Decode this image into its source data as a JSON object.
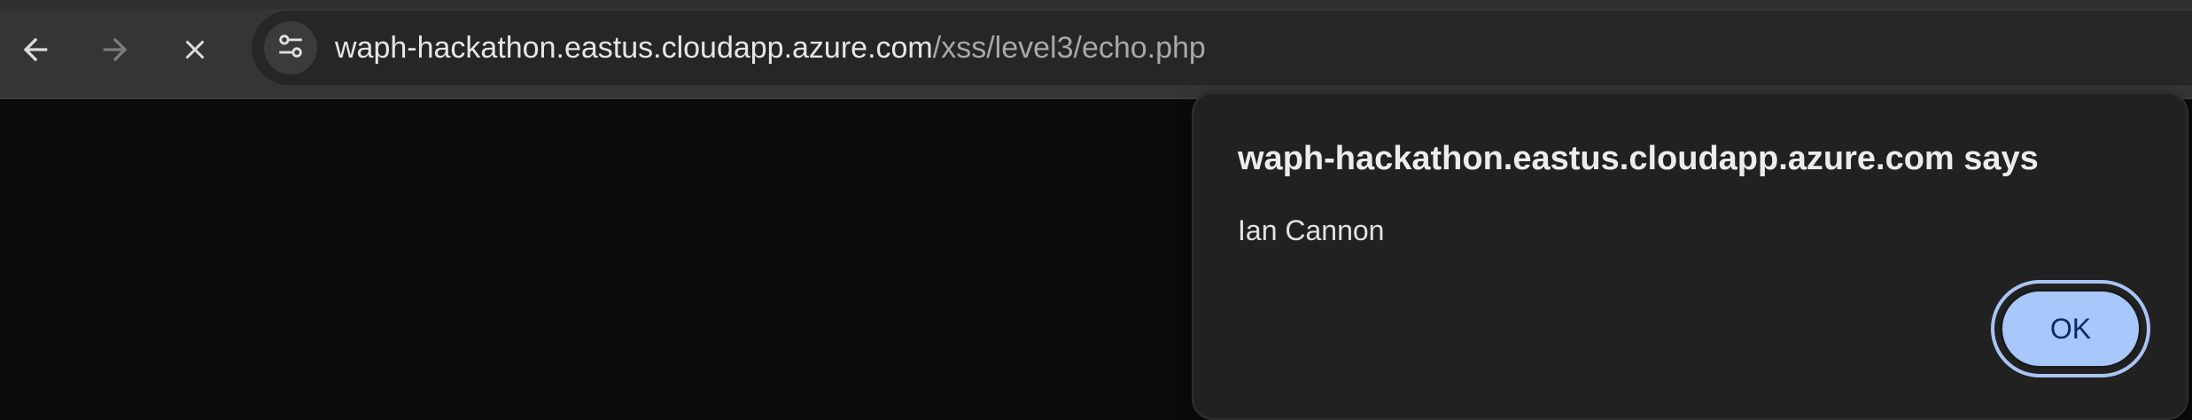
{
  "browser": {
    "url": {
      "host": "waph-hackathon.eastus.cloudapp.azure.com",
      "path": "/xss/level3/echo.php"
    },
    "icons": {
      "back": "arrow-left-icon",
      "forward": "arrow-right-icon",
      "stop": "close-icon",
      "site_info": "tune-icon"
    },
    "forward_enabled": false
  },
  "dialog": {
    "title": "waph-hackathon.eastus.cloudapp.azure.com says",
    "message": "Ian Cannon",
    "ok_label": "OK"
  },
  "colors": {
    "toolbar": "#353535",
    "omnibox": "#262626",
    "page_background": "#0b0b0b",
    "dialog_background": "#212121",
    "ok_button": "#a8c7fa",
    "ok_text": "#0a2a66"
  }
}
